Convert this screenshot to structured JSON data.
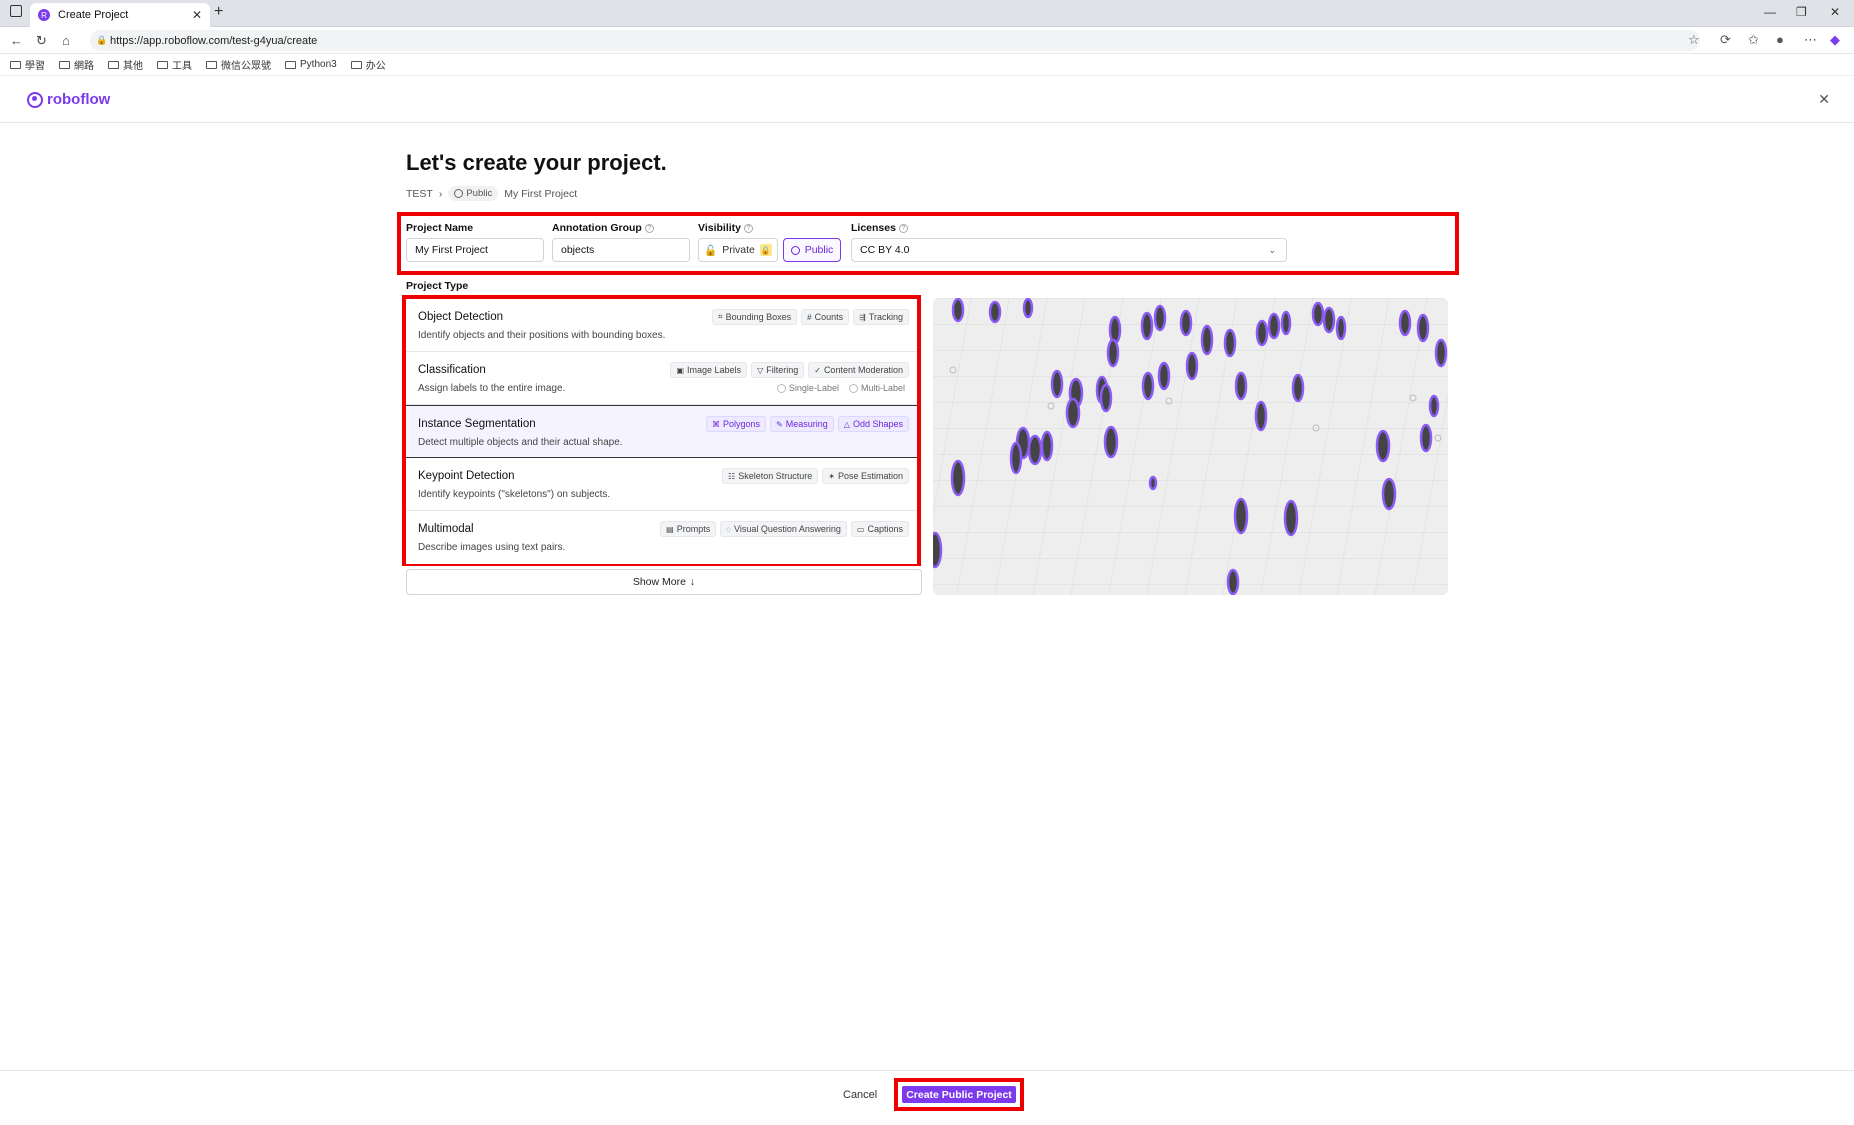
{
  "browser": {
    "tab_title": "Create Project",
    "url": "https://app.roboflow.com/test-g4yua/create",
    "bookmarks": [
      "學習",
      "網路",
      "其他",
      "工具",
      "微信公眾號",
      "Python3",
      "办公"
    ]
  },
  "app": {
    "logo_text": "roboflow"
  },
  "page": {
    "title": "Let's create your project.",
    "breadcrumb": {
      "workspace": "TEST",
      "visibility": "Public",
      "project": "My First Project"
    }
  },
  "settings": {
    "project_name_label": "Project Name",
    "project_name_value": "My First Project",
    "annotation_group_label": "Annotation Group",
    "annotation_group_value": "objects",
    "visibility_label": "Visibility",
    "visibility_private": "Private",
    "visibility_public": "Public",
    "visibility_selected": "Public",
    "licenses_label": "Licenses",
    "license_value": "CC BY 4.0"
  },
  "project_type": {
    "label": "Project Type",
    "types": [
      {
        "name": "Object Detection",
        "desc": "Identify objects and their positions with bounding boxes.",
        "chips": [
          "Bounding Boxes",
          "Counts",
          "Tracking"
        ]
      },
      {
        "name": "Classification",
        "desc": "Assign labels to the entire image.",
        "chips": [
          "Image Labels",
          "Filtering",
          "Content Moderation"
        ],
        "options": [
          "Single-Label",
          "Multi-Label"
        ]
      },
      {
        "name": "Instance Segmentation",
        "desc": "Detect multiple objects and their actual shape.",
        "chips": [
          "Polygons",
          "Measuring",
          "Odd Shapes"
        ],
        "selected": true
      },
      {
        "name": "Keypoint Detection",
        "desc": "Identify keypoints (\"skeletons\") on subjects.",
        "chips": [
          "Skeleton Structure",
          "Pose Estimation"
        ]
      },
      {
        "name": "Multimodal",
        "desc": "Describe images using text pairs.",
        "chips": [
          "Prompts",
          "Visual Question Answering",
          "Captions"
        ]
      }
    ],
    "show_more": "Show More"
  },
  "footer": {
    "cancel": "Cancel",
    "create": "Create Public Project"
  },
  "colors": {
    "accent": "#7c3aed",
    "highlight": "#ee0000"
  }
}
